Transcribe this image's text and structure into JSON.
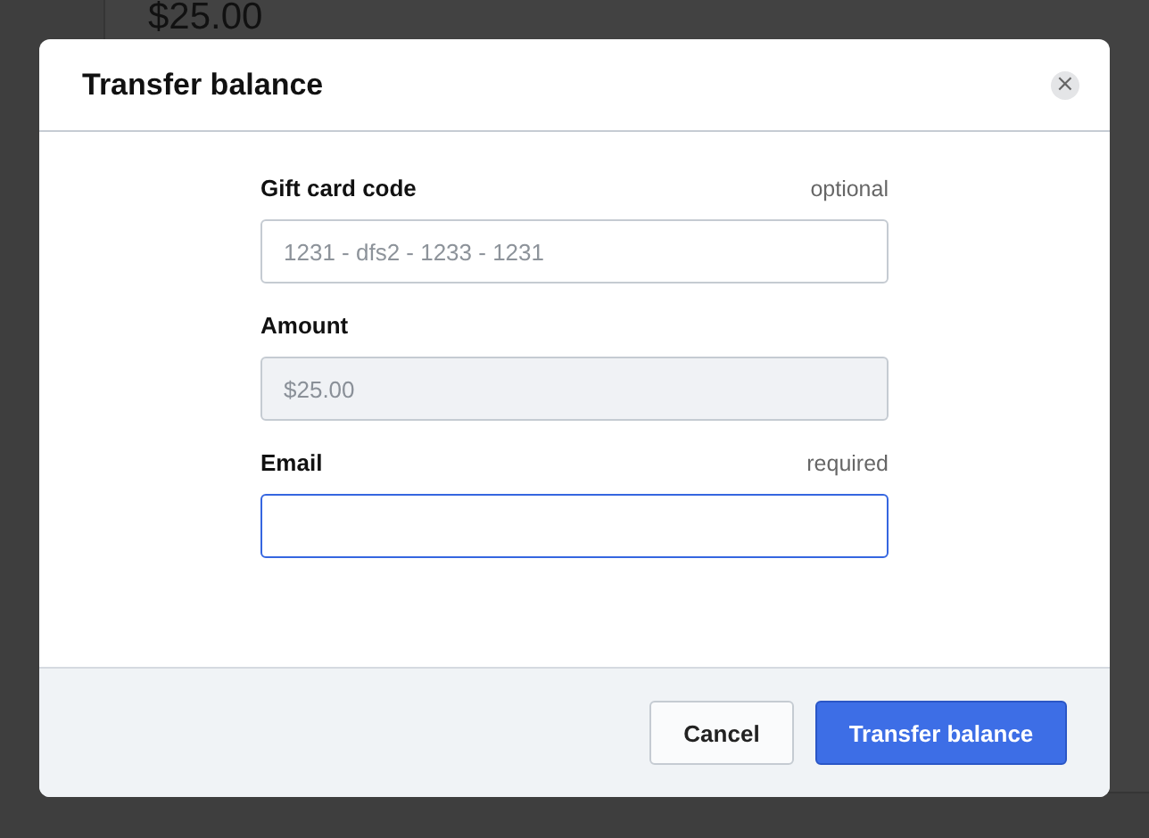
{
  "background": {
    "amount": "$25.00"
  },
  "dialog": {
    "title": "Transfer balance",
    "close": "×",
    "fields": [
      {
        "label": "Gift card code",
        "note": "optional",
        "placeholder": "1231 - dfs2 - 1233 - 1231",
        "disabled": false,
        "focused": false
      },
      {
        "label": "Amount",
        "value": "$25.00",
        "disabled": true,
        "focused": false
      },
      {
        "label": "Email",
        "note": "required",
        "disabled": false,
        "focused": true
      }
    ],
    "buttons": [
      {
        "label": "Cancel",
        "kind": "secondary"
      },
      {
        "label": "Transfer balance",
        "kind": "primary"
      }
    ]
  }
}
